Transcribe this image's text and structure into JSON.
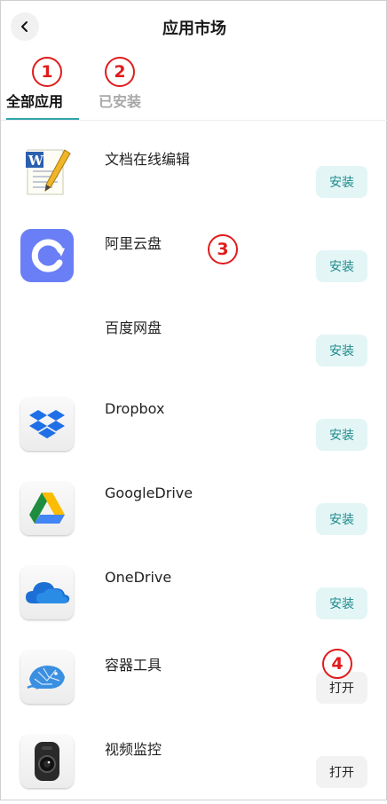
{
  "header": {
    "title": "应用市场"
  },
  "tabs": [
    {
      "label": "全部应用"
    },
    {
      "label": "已安装"
    }
  ],
  "markers": [
    "1",
    "2",
    "3",
    "4"
  ],
  "apps": [
    {
      "name": "文档在线编辑",
      "action": "安装"
    },
    {
      "name": "阿里云盘",
      "action": "安装"
    },
    {
      "name": "百度网盘",
      "action": "安装"
    },
    {
      "name": "Dropbox",
      "action": "安装"
    },
    {
      "name": "GoogleDrive",
      "action": "安装"
    },
    {
      "name": "OneDrive",
      "action": "安装"
    },
    {
      "name": "容器工具",
      "action": "打开"
    },
    {
      "name": "视频监控",
      "action": "打开"
    }
  ],
  "colors": {
    "accent": "#2ea5a8",
    "install_bg": "#e3f5f5",
    "install_text": "#1f8a8d",
    "marker": "#e01b1b"
  }
}
